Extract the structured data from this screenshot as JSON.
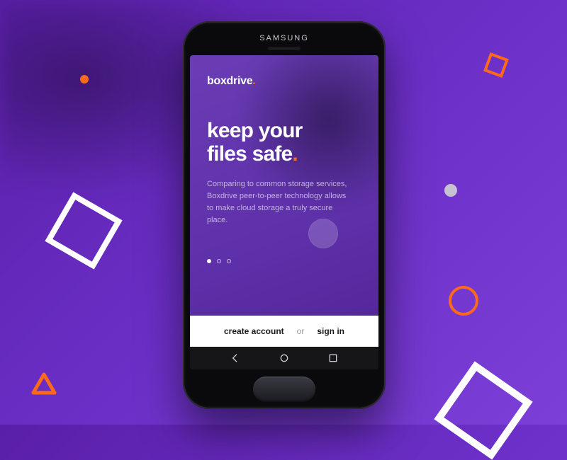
{
  "device": {
    "brand": "SAMSUNG"
  },
  "app": {
    "logo": "boxdrive",
    "logo_sep": ".",
    "headline_line1": "keep your",
    "headline_line2": "files safe",
    "headline_sep": ".",
    "body": "Comparing to common storage services, Boxdrive peer-to-peer technology allows to make cloud storage a truly secure place.",
    "pager": {
      "count": 3,
      "active": 0
    }
  },
  "actions": {
    "create": "create account",
    "or": "or",
    "signin": "sign in"
  },
  "colors": {
    "accent_orange": "#ff6a1a",
    "bg_purple": "#5d2fa8",
    "white": "#ffffff"
  }
}
